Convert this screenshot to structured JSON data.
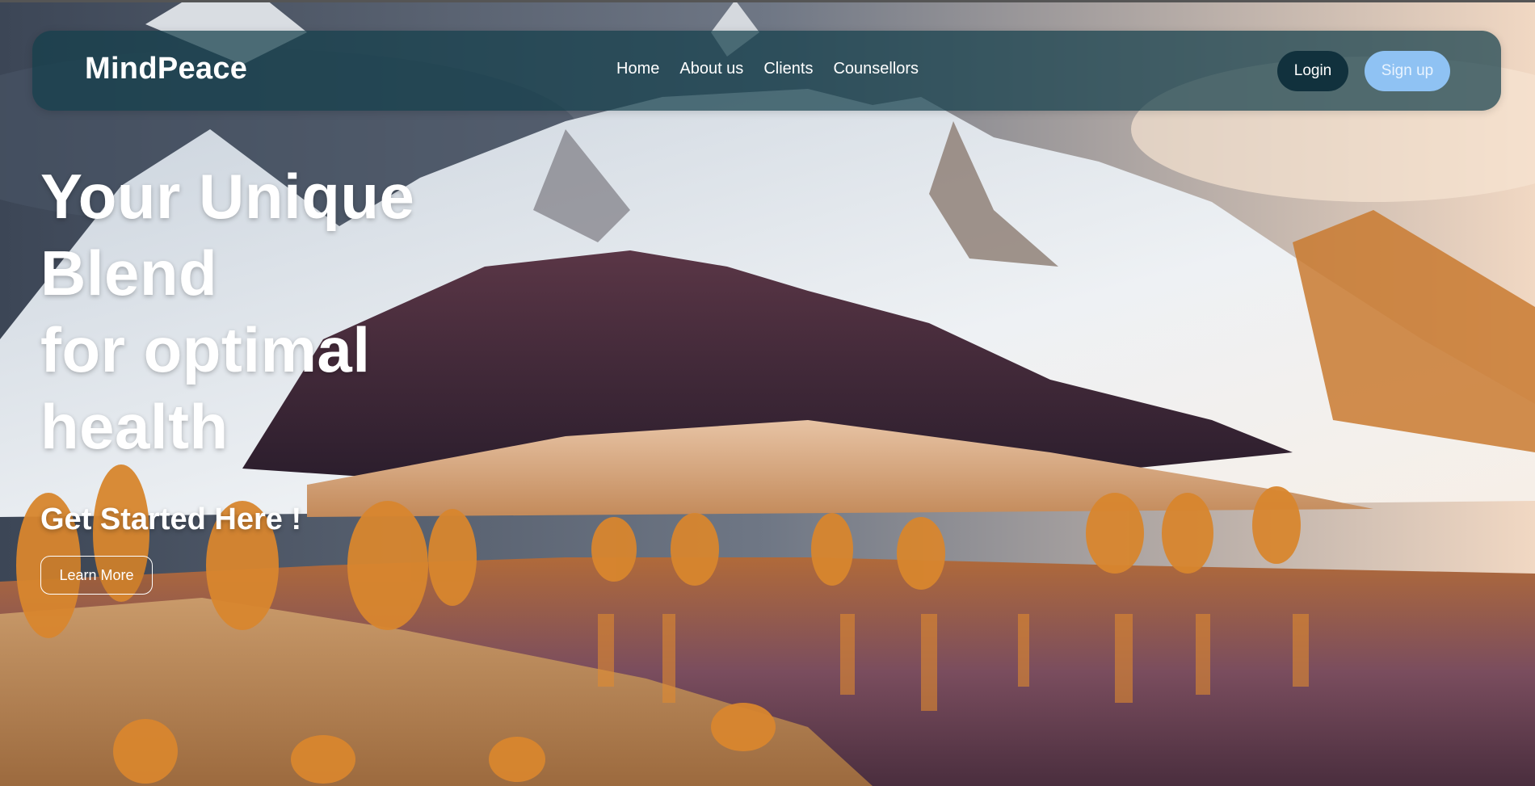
{
  "brand": "MindPeace",
  "nav": {
    "links": [
      "Home",
      "About us",
      "Clients",
      "Counsellors"
    ],
    "login": "Login",
    "signup": "Sign up"
  },
  "hero": {
    "headline_lines": [
      "Your Unique",
      "Blend",
      "for optimal",
      "health"
    ],
    "subheading": "Get Started Here !",
    "cta": "Learn More"
  },
  "colors": {
    "navbar_bg": "#143e4b",
    "login_bg": "#11313d",
    "signup_bg": "#8fc2f3",
    "text": "#ffffff"
  }
}
